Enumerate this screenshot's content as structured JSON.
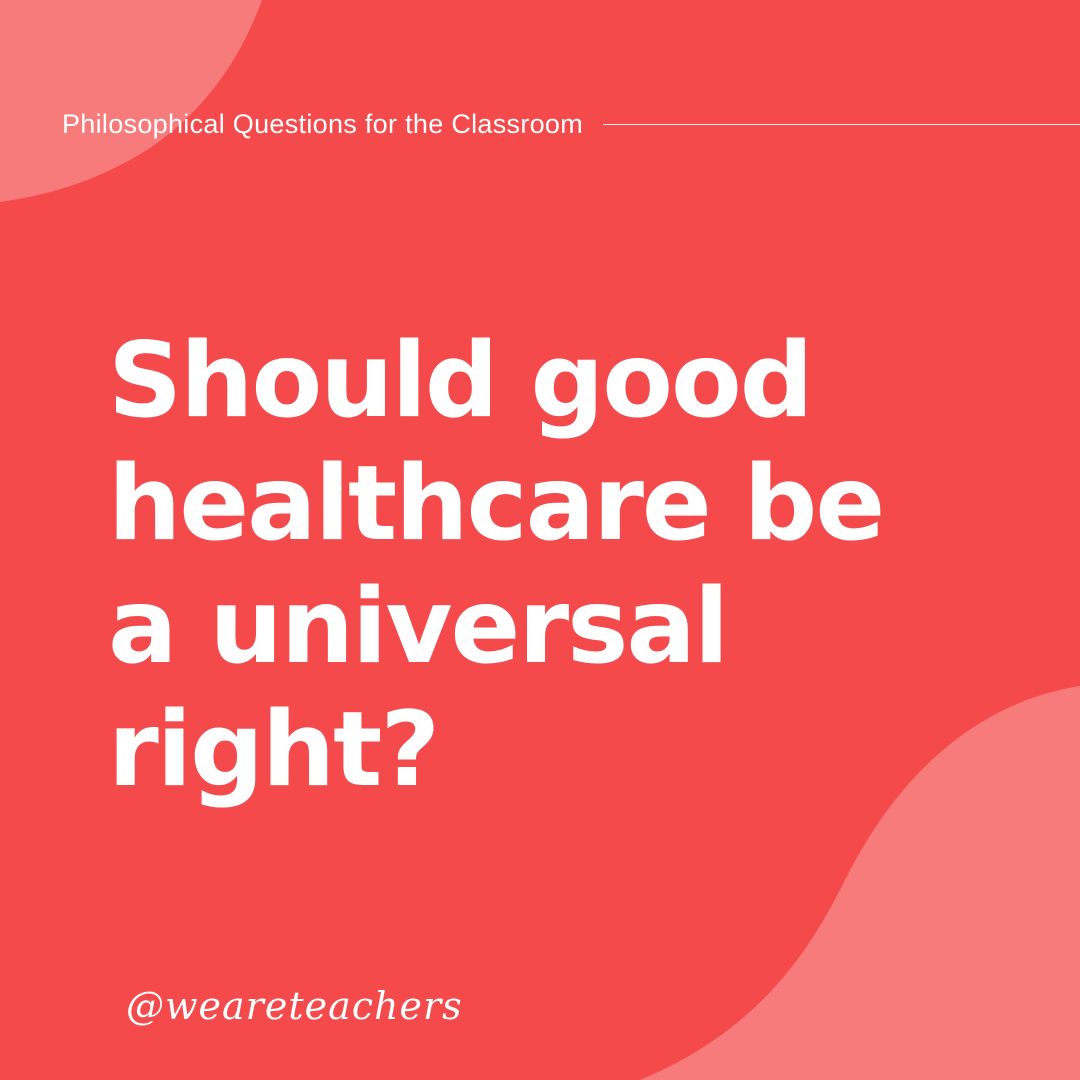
{
  "header": {
    "title": "Philosophical Questions for the Classroom"
  },
  "question": {
    "lines": [
      "Should good",
      "healthcare be",
      "a universal",
      "right?"
    ]
  },
  "footer": {
    "handle": "@weareteachers"
  },
  "colors": {
    "background": "#f54a4b",
    "accent_blob": "#f87b7b",
    "text": "#ffffff"
  }
}
